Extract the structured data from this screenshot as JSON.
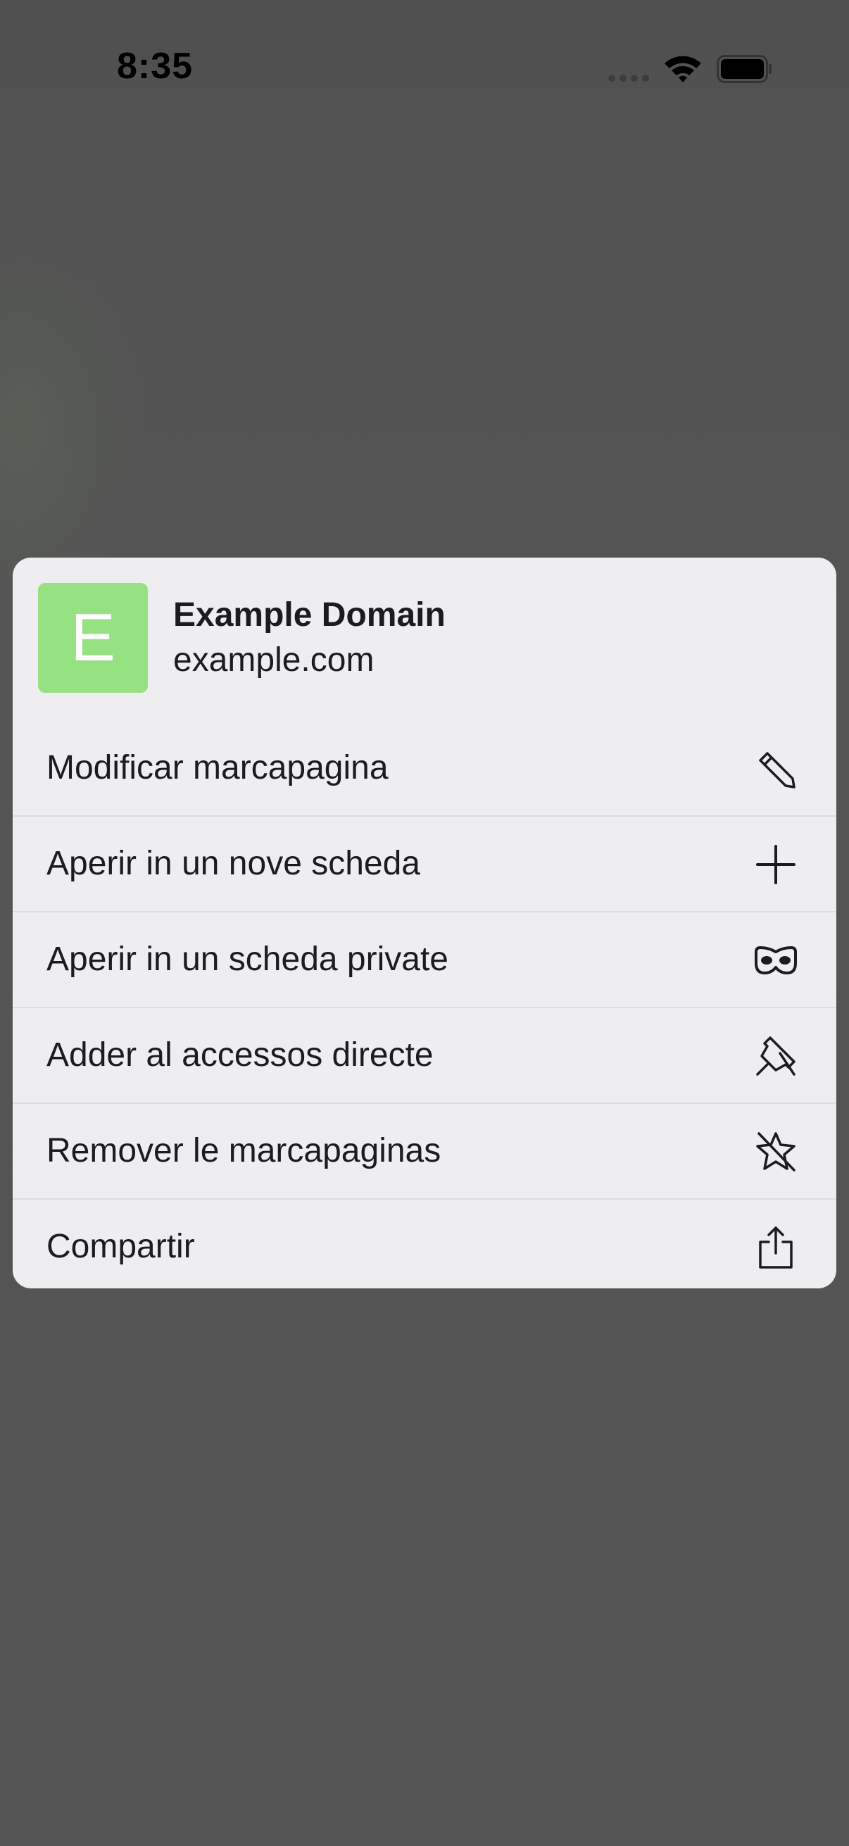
{
  "status_bar": {
    "time": "8:35",
    "icons": [
      "signal-dots-icon",
      "wifi-icon",
      "battery-icon"
    ]
  },
  "menu": {
    "site": {
      "favicon_letter": "E",
      "favicon_color": "#96e282",
      "title": "Example Domain",
      "domain": "example.com"
    },
    "items": [
      {
        "label": "Modificar marcapagina",
        "icon": "pencil-icon"
      },
      {
        "label": "Aperir in un nove scheda",
        "icon": "plus-icon"
      },
      {
        "label": "Aperir in un scheda private",
        "icon": "private-mask-icon"
      },
      {
        "label": "Adder al accessos directe",
        "icon": "pin-icon"
      },
      {
        "label": "Remover le marcapaginas",
        "icon": "star-slash-icon"
      },
      {
        "label": "Compartir",
        "icon": "share-icon"
      }
    ]
  },
  "colors": {
    "backdrop": "#535353",
    "menu_background": "#eeeef0",
    "text": "#1c1c1e",
    "divider": "#dcdcde"
  }
}
